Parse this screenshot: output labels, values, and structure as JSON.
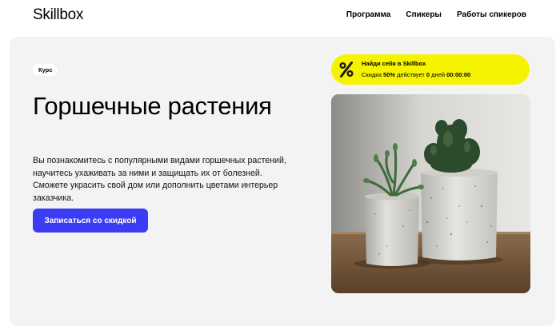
{
  "header": {
    "logo": "Skillbox",
    "nav": [
      {
        "label": "Программа"
      },
      {
        "label": "Спикеры"
      },
      {
        "label": "Работы спикеров"
      }
    ]
  },
  "hero": {
    "tag": "Курс",
    "title": "Горшечные растения",
    "description": "Вы познакомитесь с популярными видами горшечных растений, научитесь ухаживать за ними и защищать их от болезней. Сможете украсить свой дом или дополнить цветами интерьер заказчика.",
    "cta_label": "Записаться со скидкой"
  },
  "promo": {
    "icon": "percent-icon",
    "title": "Найди себя в Skillbox",
    "sub_prefix": "Скидка ",
    "discount": "50%",
    "sub_middle": " действует ",
    "days": "0",
    "sub_days_word": " дней ",
    "timer": "00:00:00"
  },
  "image": {
    "subject": "potted-plants-photo"
  },
  "colors": {
    "accent": "#3c3cf4",
    "promo": "#f6f300",
    "hero_bg": "#f3f3f3"
  }
}
